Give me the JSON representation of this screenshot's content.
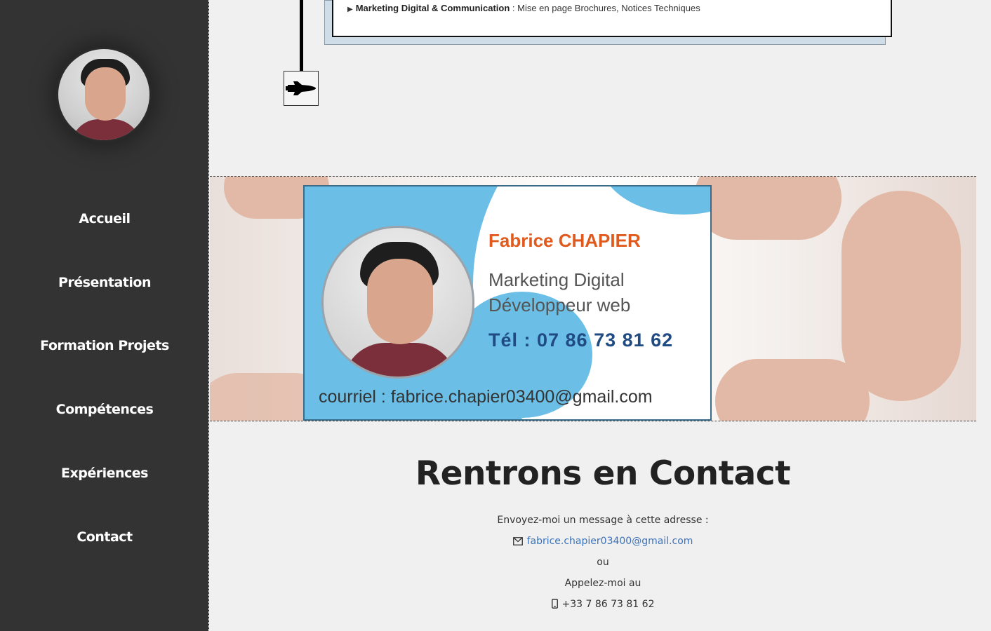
{
  "sidebar": {
    "nav": [
      {
        "label": "Accueil"
      },
      {
        "label": "Présentation"
      },
      {
        "label": "Formation Projets"
      },
      {
        "label": "Compétences"
      },
      {
        "label": "Expériences"
      },
      {
        "label": "Contact"
      }
    ]
  },
  "timeline": {
    "item_title": "Marketing Digital & Communication",
    "item_text": " : Mise en page Brochures, Notices Techniques",
    "icon": "rocket-icon"
  },
  "business_card": {
    "name_first": "Fabrice ",
    "name_last": "CHAPIER",
    "role_1": "Marketing Digital",
    "role_2": "Développeur web",
    "tel": "Tél : 07 86 73 81 62",
    "mail": "courriel : fabrice.chapier03400@gmail.com"
  },
  "contact": {
    "title_strong": "Rentrons",
    "title_rest": " en Contact",
    "intro": "Envoyez-moi un message à cette adresse :",
    "email": "fabrice.chapier03400@gmail.com",
    "or": "ou",
    "call": "Appelez-moi au",
    "phone": "+33 7 86 73 81 62"
  },
  "colors": {
    "sidebar_bg": "#333333",
    "page_bg": "#f0f0f0",
    "link": "#3b73b9",
    "card_blue": "#6bbfe6",
    "name_orange": "#e05a1e"
  }
}
